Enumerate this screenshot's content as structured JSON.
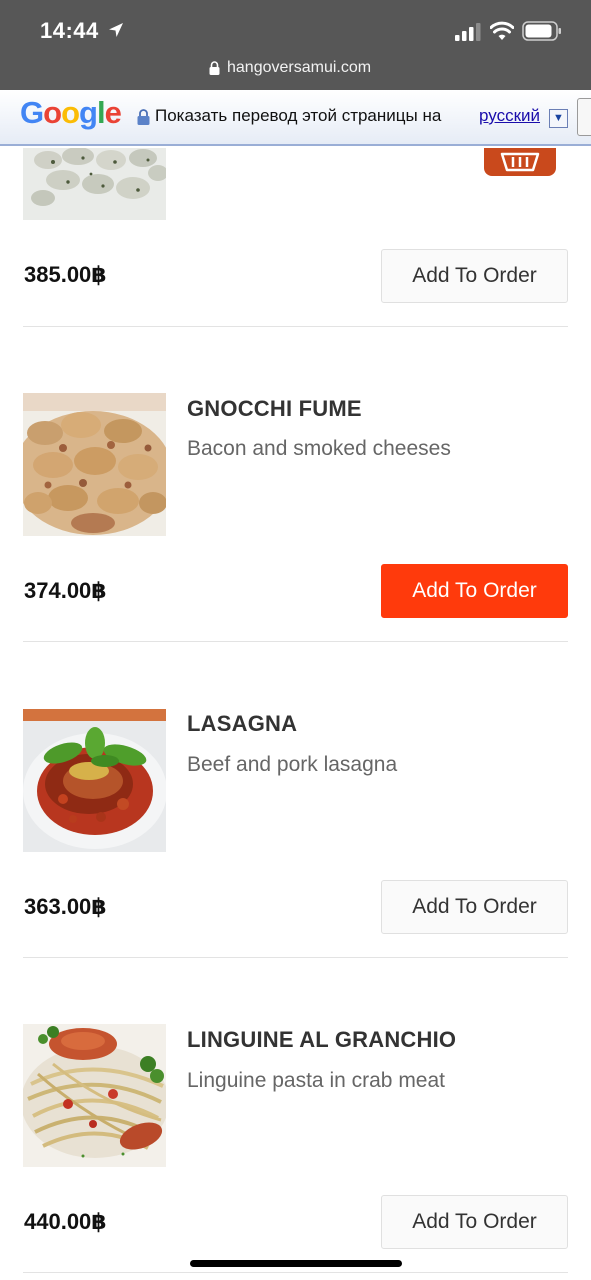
{
  "status_bar": {
    "time": "14:44",
    "icons": [
      "location-arrow-icon",
      "cell-signal-icon",
      "wifi-icon",
      "battery-icon"
    ]
  },
  "browser": {
    "url": "hangoversamui.com"
  },
  "translate_bar": {
    "logo": "Google",
    "prompt": "Показать перевод этой страницы на",
    "language": "русский",
    "dropdown_glyph": "▼"
  },
  "colors": {
    "accent": "#ff3a0c",
    "status_bar": "#575757",
    "link": "#1a0dab"
  },
  "previous_item": {
    "price": "385.00฿",
    "button_label": "Add To Order"
  },
  "menu_items": [
    {
      "name": "GNOCCHI FUME",
      "description": "Bacon and smoked cheeses",
      "price": "374.00฿",
      "button_label": "Add To Order",
      "button_active": true
    },
    {
      "name": "LASAGNA",
      "description": "Beef and pork lasagna",
      "price": "363.00฿",
      "button_label": "Add To Order",
      "button_active": false
    },
    {
      "name": "LINGUINE AL GRANCHIO",
      "description": "Linguine pasta in crab meat",
      "price": "440.00฿",
      "button_label": "Add To Order",
      "button_active": false
    }
  ]
}
